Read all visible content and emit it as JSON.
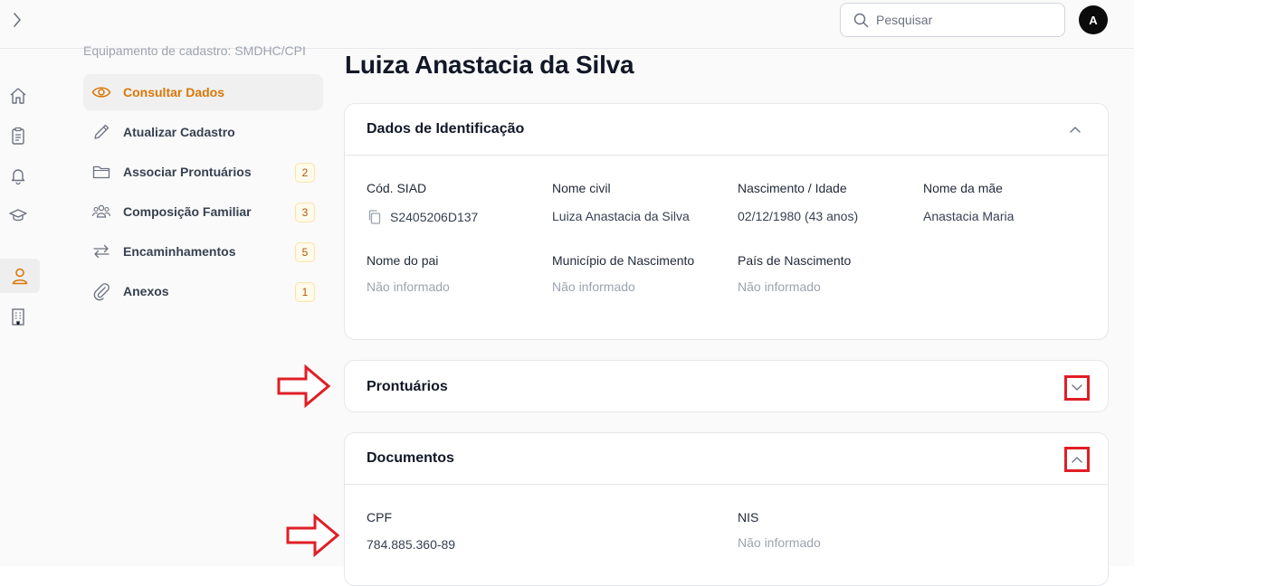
{
  "header": {
    "search_placeholder": "Pesquisar",
    "avatar_initial": "A"
  },
  "subnav": {
    "caption": "Equipamento de cadastro: SMDHC/CPI",
    "items": [
      {
        "label": "Consultar Dados",
        "icon": "eye-icon",
        "active": true,
        "badge": ""
      },
      {
        "label": "Atualizar Cadastro",
        "icon": "pencil-icon",
        "active": false,
        "badge": ""
      },
      {
        "label": "Associar Prontuários",
        "icon": "folder-icon",
        "active": false,
        "badge": "2"
      },
      {
        "label": "Composição Familiar",
        "icon": "people-icon",
        "active": false,
        "badge": "3"
      },
      {
        "label": "Encaminhamentos",
        "icon": "arrows-exchange-icon",
        "active": false,
        "badge": "5"
      },
      {
        "label": "Anexos",
        "icon": "paperclip-icon",
        "active": false,
        "badge": "1"
      }
    ]
  },
  "rail": [
    "home-icon",
    "clipboard-icon",
    "bell-icon",
    "graduation-cap-icon",
    "user-icon",
    "building-icon"
  ],
  "page": {
    "title": "Luiza Anastacia da Silva"
  },
  "identificacao": {
    "title": "Dados de Identificação",
    "fields": [
      {
        "label": "Cód. SIAD",
        "value": "S2405206D137"
      },
      {
        "label": "Nome civil",
        "value": "Luiza Anastacia da Silva"
      },
      {
        "label": "Nascimento / Idade",
        "value": "02/12/1980 (43 anos)"
      },
      {
        "label": "Nome da mãe",
        "value": "Anastacia Maria"
      },
      {
        "label": "Nome do pai",
        "value": "Não informado"
      },
      {
        "label": "Município de Nascimento",
        "value": "Não informado"
      },
      {
        "label": "País de Nascimento",
        "value": "Não informado"
      }
    ]
  },
  "prontuarios": {
    "title": "Prontuários"
  },
  "documentos": {
    "title": "Documentos",
    "fields": [
      {
        "label": "CPF",
        "value": "784.885.360-89"
      },
      {
        "label": "NIS",
        "value": "Não informado"
      }
    ]
  },
  "colors": {
    "accent": "#d97706",
    "annotation_red": "#e01e26"
  }
}
